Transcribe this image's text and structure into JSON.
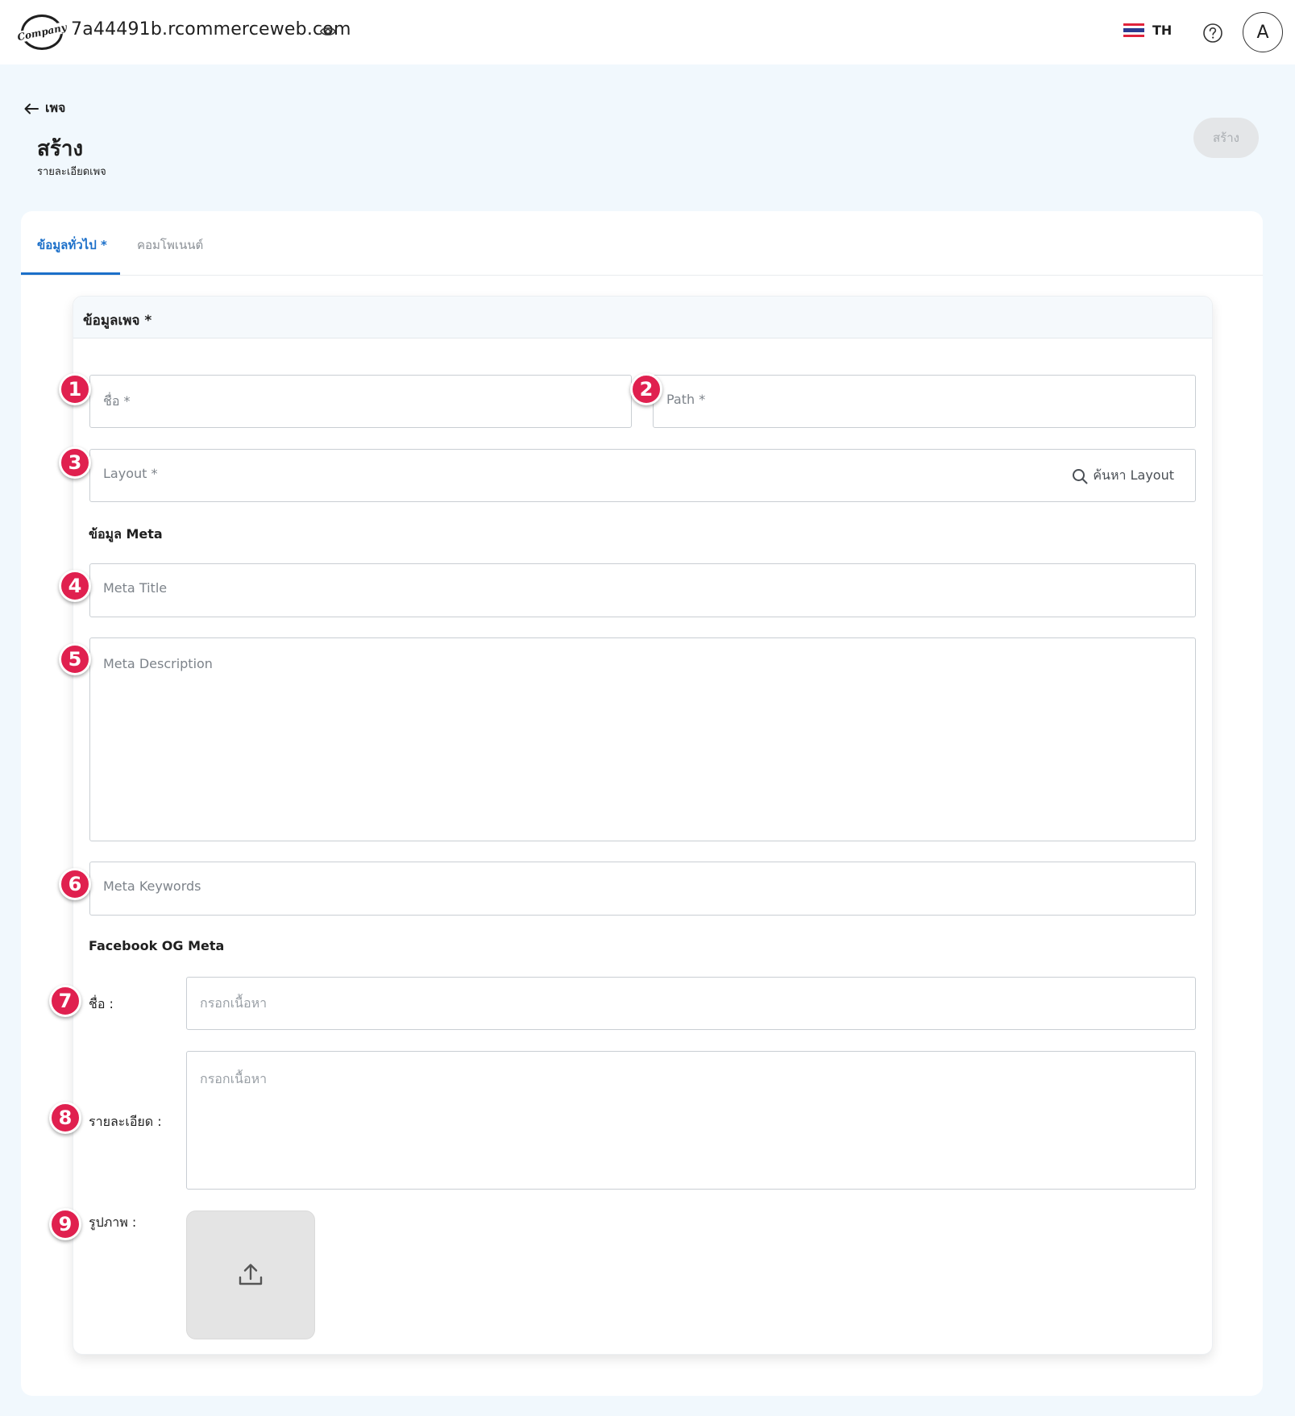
{
  "topbar": {
    "logo_text": "Company",
    "site_url": "7a44491b.rcommerceweb.com",
    "view_icon": "eye-icon",
    "language_code": "TH",
    "flag_colors": [
      "#e0233b",
      "#ffffff",
      "#2b3a8f",
      "#ffffff",
      "#e0233b"
    ],
    "help_icon": "question-circle-icon",
    "avatar_initial": "A"
  },
  "header": {
    "back_label": "เพจ",
    "title": "สร้าง",
    "subtitle": "รายละเอียดเพจ",
    "create_button_label": "สร้าง"
  },
  "tabs": [
    {
      "label": "ข้อมูลทั่วไป *",
      "active": true
    },
    {
      "label": "คอมโพเนนต์",
      "active": false
    }
  ],
  "panel": {
    "title": "ข้อมูลเพจ *",
    "fields": {
      "name": {
        "placeholder": "ชื่อ *"
      },
      "path": {
        "placeholder": "Path *"
      },
      "layout": {
        "placeholder": "Layout *",
        "search_label": "ค้นหา Layout"
      }
    },
    "meta_section": {
      "title": "ข้อมูล Meta",
      "meta_title": {
        "placeholder": "Meta Title"
      },
      "meta_description": {
        "placeholder": "Meta Description"
      },
      "meta_keywords": {
        "placeholder": "Meta Keywords"
      }
    },
    "og_section": {
      "title": "Facebook OG Meta",
      "name_label": "ชื่อ :",
      "name_placeholder": "กรอกเนื้อหา",
      "description_label": "รายละเอียด :",
      "description_placeholder": "กรอกเนื้อหา",
      "image_label": "รูปภาพ :",
      "upload_icon": "upload-icon"
    }
  },
  "markers": [
    "1",
    "2",
    "3",
    "4",
    "5",
    "6",
    "7",
    "8",
    "9"
  ],
  "colors": {
    "accent": "#1b6fc9",
    "marker": "#e0204f",
    "page_background": "#f1f8fd",
    "disabled_button": "#e4e6e8"
  }
}
